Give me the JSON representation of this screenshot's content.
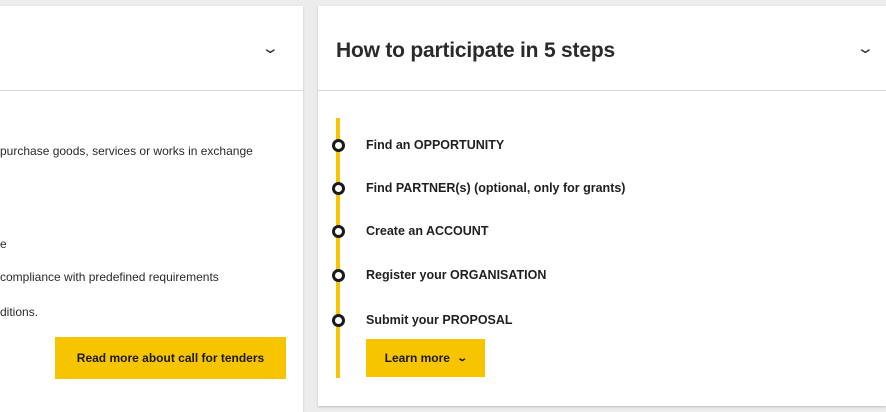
{
  "left_panel": {
    "lines": [
      "purchase goods, services or works in exchange",
      "e",
      "compliance with predefined requirements",
      "ditions."
    ],
    "button_label": "Read more about call for tenders"
  },
  "right_panel": {
    "title": "How to participate in 5 steps",
    "steps": [
      "Find an OPPORTUNITY",
      "Find PARTNER(s) (optional, only for grants)",
      "Create an ACCOUNT",
      "Register your ORGANISATION",
      "Submit your PROPOSAL"
    ],
    "button_label": "Learn more"
  },
  "icons": {
    "expand": "chevron-down-icon"
  },
  "colors": {
    "accent": "#f7c400",
    "background": "#ececec",
    "card": "#ffffff"
  }
}
